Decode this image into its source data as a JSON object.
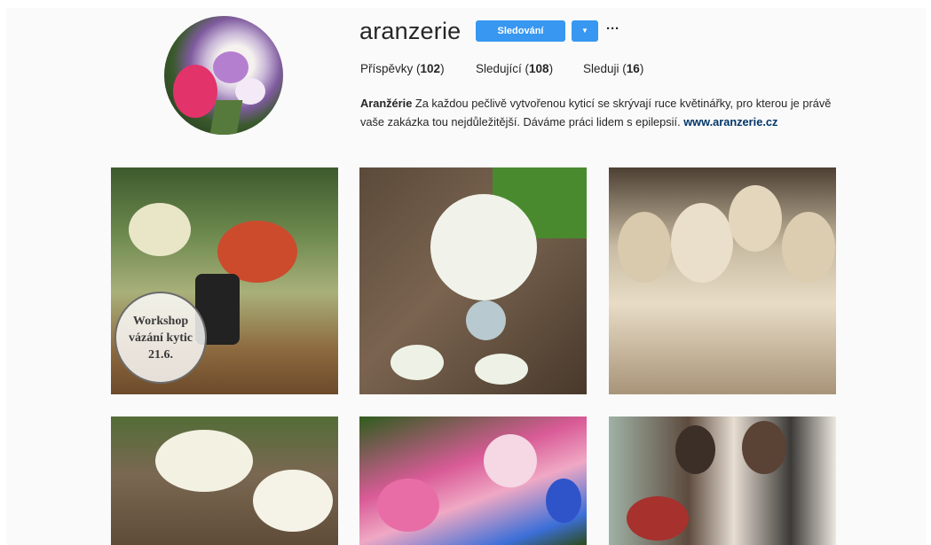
{
  "profile": {
    "username": "aranzerie",
    "follow_label": "Sledování",
    "dropdown_icon": "chevron-down-icon",
    "more_label": "···",
    "stats": {
      "posts_label": "Příspěvky",
      "posts_value": "102",
      "followers_label": "Sledující",
      "followers_value": "108",
      "following_label": "Sleduji",
      "following_value": "16"
    },
    "bio": {
      "name": "Aranžérie",
      "text": "Za každou pečlivě vytvořenou kyticí se skrývají ruce květinářky, pro kterou je právě vaše zakázka tou nejdůležitější. Dáváme práci lidem s epilepsií.",
      "link": "www.aranzerie.cz"
    }
  },
  "posts": [
    {
      "badge_lines": [
        "Workshop",
        "vázání kytic",
        "21.6."
      ]
    },
    {},
    {},
    {},
    {},
    {}
  ],
  "colors": {
    "accent": "#3897f0",
    "link": "#003569",
    "background": "#fafafa"
  }
}
